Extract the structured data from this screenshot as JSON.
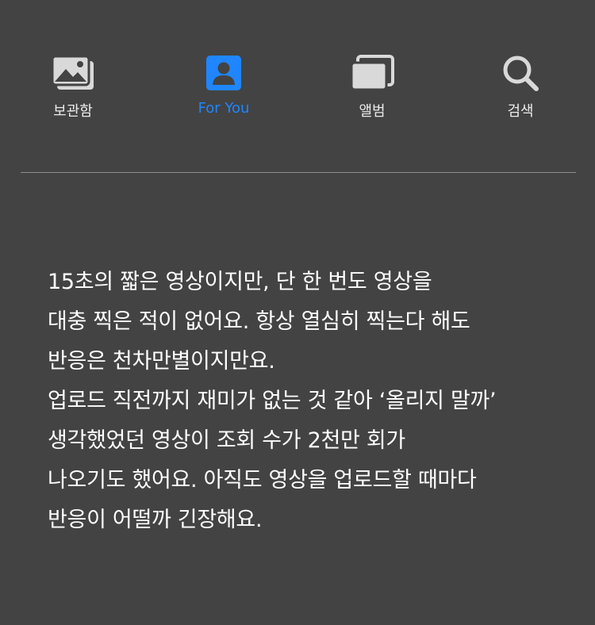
{
  "tabs": [
    {
      "label": "보관함",
      "icon": "photos-stack-icon",
      "active": false
    },
    {
      "label": "For You",
      "icon": "person-card-icon",
      "active": true
    },
    {
      "label": "앨범",
      "icon": "album-stack-icon",
      "active": false
    },
    {
      "label": "검색",
      "icon": "search-icon",
      "active": false
    }
  ],
  "colors": {
    "background": "#434343",
    "active": "#1f86ff",
    "icon": "#d9d9d9",
    "divider": "#8c8c8c"
  },
  "body": {
    "lines": [
      "15초의 짧은 영상이지만, 단 한 번도 영상을",
      "대충 찍은 적이 없어요. 항상 열심히 찍는다 해도",
      "반응은 천차만별이지만요.",
      "업로드 직전까지 재미가 없는 것 같아 ‘올리지 말까’",
      "생각했었던 영상이 조회 수가 2천만 회가",
      "나오기도 했어요. 아직도 영상을 업로드할 때마다",
      "반응이 어떨까 긴장해요."
    ]
  }
}
